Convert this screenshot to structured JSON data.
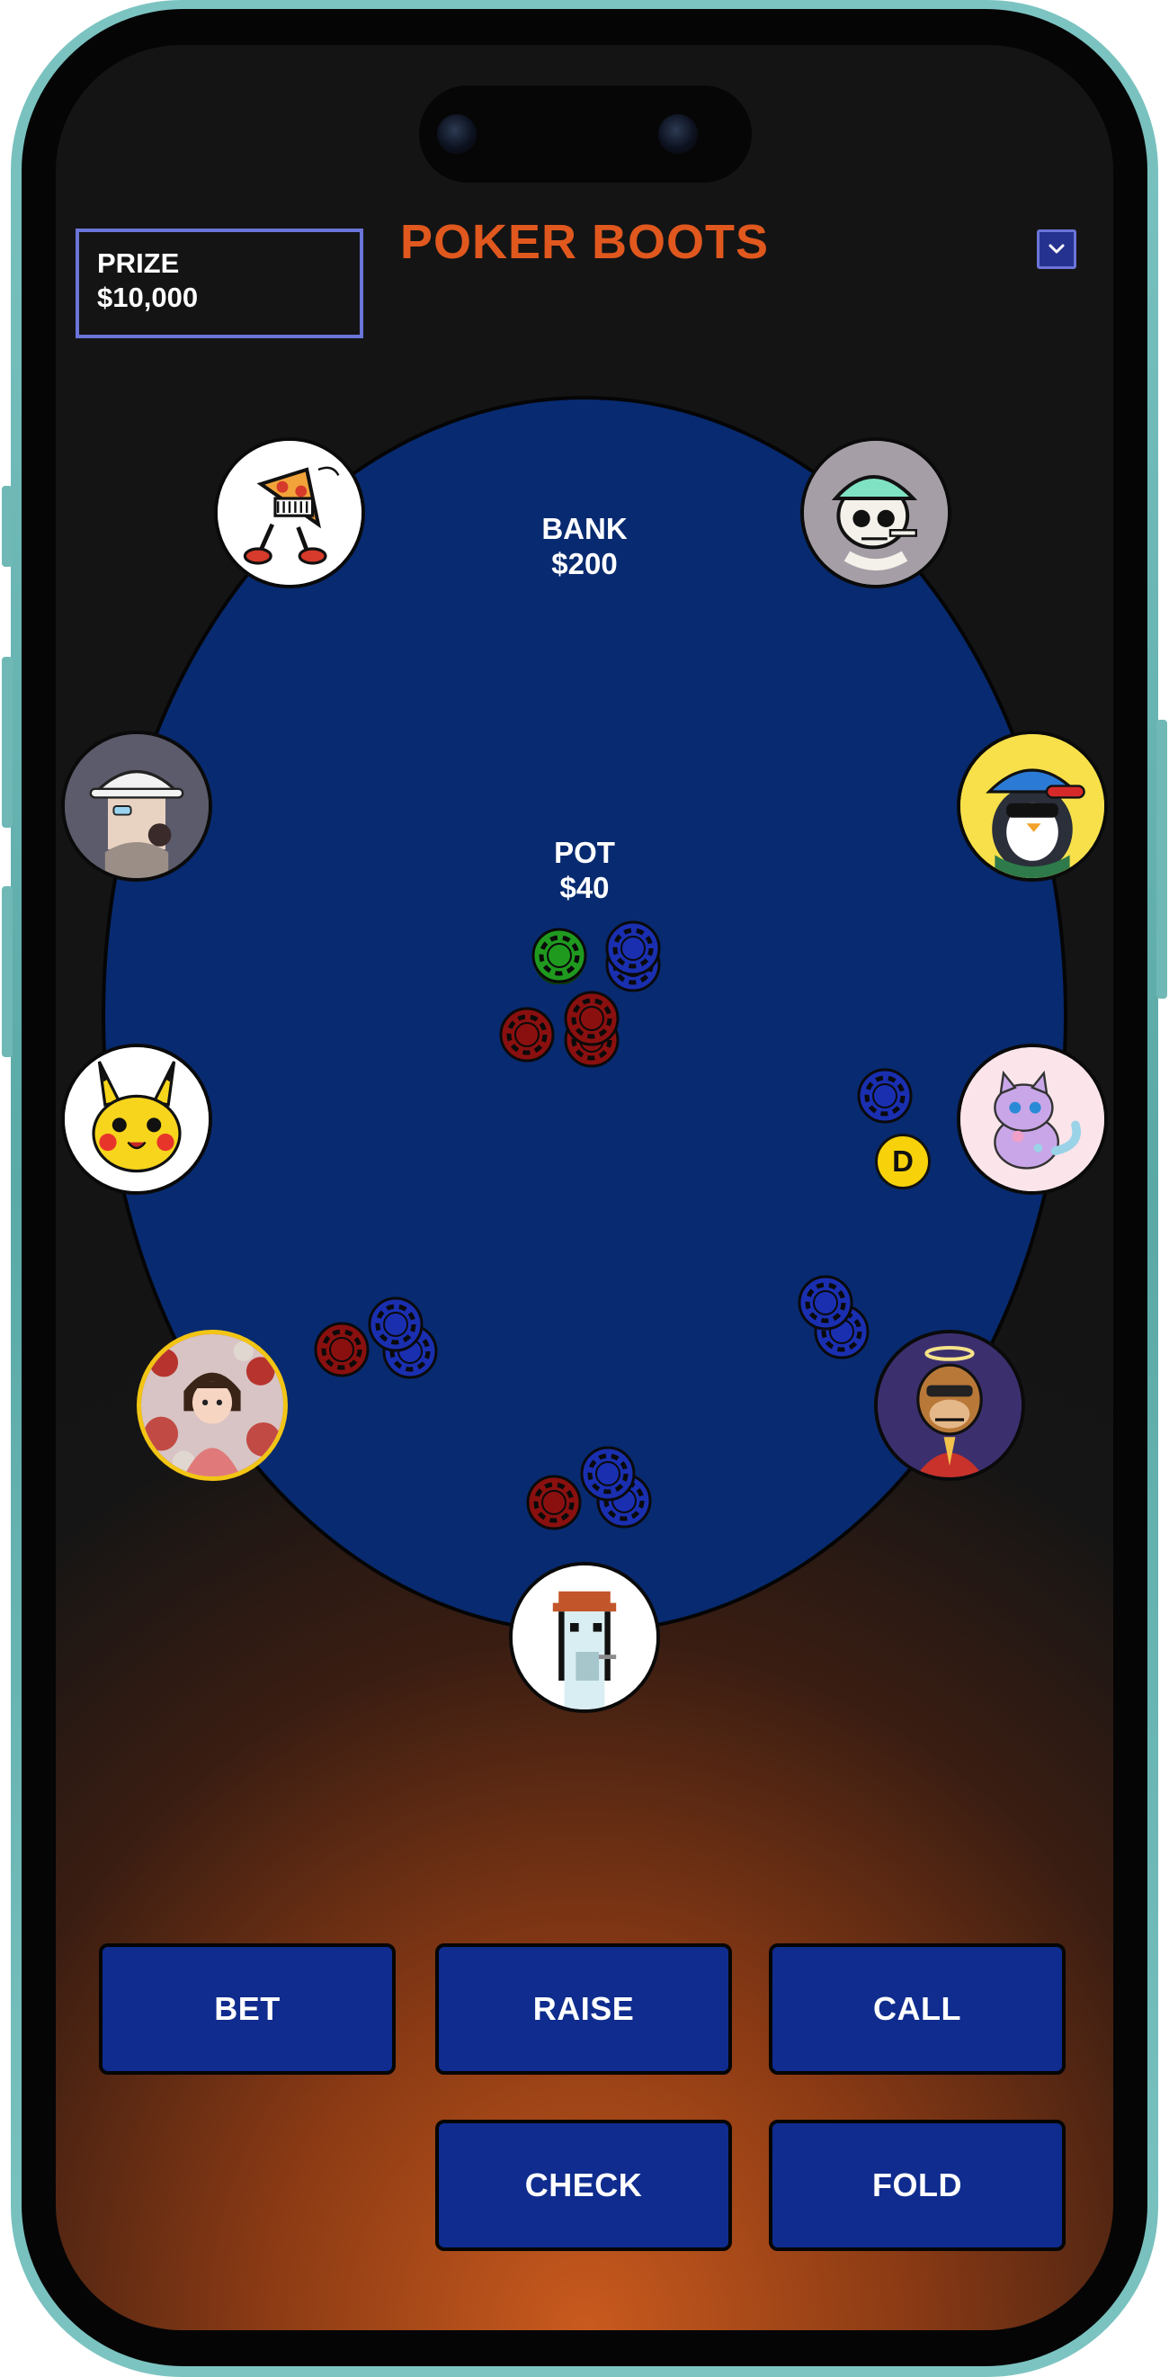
{
  "app": {
    "title": "POKER BOOTS",
    "prize_label": "PRIZE",
    "prize_value": "$10,000"
  },
  "table": {
    "bank_label": "BANK",
    "bank_value": "$200",
    "pot_label": "POT",
    "pot_value": "$40",
    "dealer_marker": "D"
  },
  "players": [
    {
      "id": "pizza",
      "avatar": "pizza-mascot-avatar"
    },
    {
      "id": "skeleton",
      "avatar": "skeleton-helmet-avatar"
    },
    {
      "id": "bucket-hat",
      "avatar": "bucket-hat-avatar"
    },
    {
      "id": "penguin",
      "avatar": "penguin-cap-avatar"
    },
    {
      "id": "pikachu",
      "avatar": "pikachu-avatar"
    },
    {
      "id": "cat",
      "avatar": "pink-cat-avatar"
    },
    {
      "id": "girl",
      "avatar": "anime-girl-avatar",
      "active": true
    },
    {
      "id": "ape",
      "avatar": "halo-ape-avatar"
    },
    {
      "id": "punk",
      "avatar": "pixel-punk-avatar"
    }
  ],
  "actions": {
    "bet": "BET",
    "raise": "RAISE",
    "call": "CALL",
    "check": "CHECK",
    "fold": "FOLD"
  },
  "colors": {
    "accent": "#e0581e",
    "table": "#082a70",
    "button": "#0f2c8e",
    "border_highlight": "#6b74d8",
    "active_seat": "#f2c514",
    "chip_blue": "#1a2fb0",
    "chip_red": "#8a1010",
    "chip_green": "#1f9a1f"
  }
}
